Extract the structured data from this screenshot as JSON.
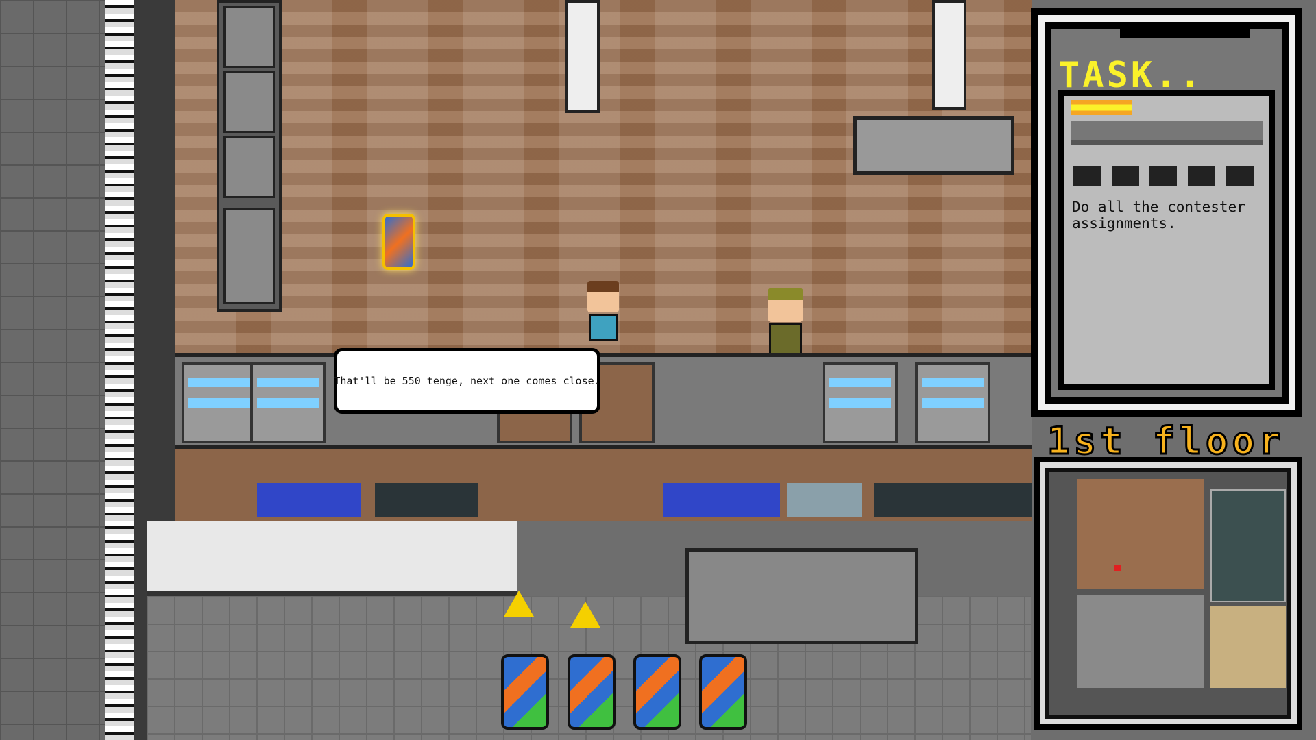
{
  "dialogue": {
    "text": "That'll be 550 tenge, next one comes close."
  },
  "task_panel": {
    "title": "TASK..",
    "progress_percent": 32,
    "assignment_slots_total": 5,
    "assignment_slots_completed": 0,
    "description": "Do all the contester assignments."
  },
  "location": {
    "floor_label": "1st floor"
  },
  "colors": {
    "task_title": "#fbf22a",
    "floor_label": "#f7b21d",
    "progress": "#f5a623"
  }
}
